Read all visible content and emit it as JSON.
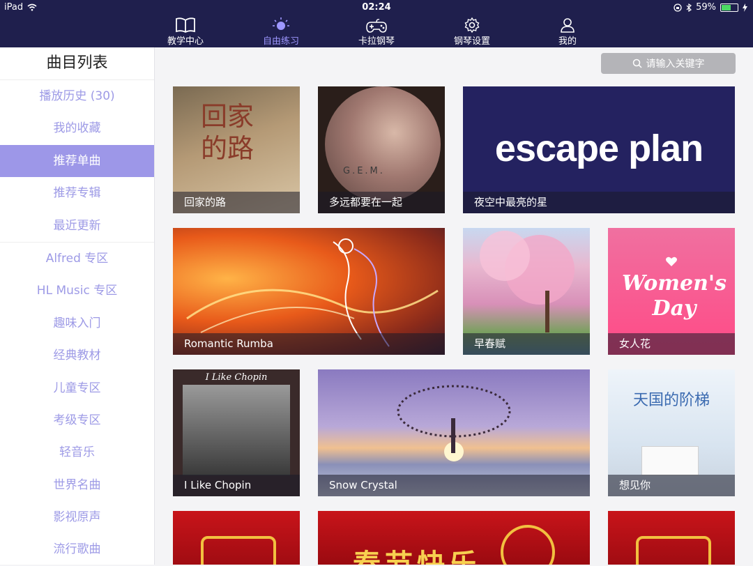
{
  "status": {
    "device": "iPad",
    "time": "02:24",
    "battery": "59%",
    "battery_level": 0.59
  },
  "nav": [
    {
      "label": "教学中心",
      "icon": "book-icon",
      "active": false
    },
    {
      "label": "自由练习",
      "icon": "sun-icon",
      "active": true
    },
    {
      "label": "卡拉钢琴",
      "icon": "gamepad-icon",
      "active": false
    },
    {
      "label": "钢琴设置",
      "icon": "gear-icon",
      "active": false
    },
    {
      "label": "我的",
      "icon": "user-icon",
      "active": false
    }
  ],
  "sidebar": {
    "title": "曲目列表",
    "items": [
      {
        "label": "播放历史 (30)"
      },
      {
        "label": "我的收藏"
      },
      {
        "label": "推荐单曲",
        "active": true
      },
      {
        "label": "推荐专辑"
      },
      {
        "label": "最近更新"
      },
      {
        "label": "Alfred 专区"
      },
      {
        "label": "HL Music 专区"
      },
      {
        "label": "趣味入门"
      },
      {
        "label": "经典教材"
      },
      {
        "label": "儿童专区"
      },
      {
        "label": "考级专区"
      },
      {
        "label": "轻音乐"
      },
      {
        "label": "世界名曲"
      },
      {
        "label": "影视原声"
      },
      {
        "label": "流行歌曲"
      }
    ]
  },
  "search": {
    "placeholder": "请输入关键字"
  },
  "tiles": {
    "t1": {
      "caption": "回家的路",
      "art_text": "回家的路"
    },
    "t2": {
      "caption": "多远都要在一起",
      "art_text": "G.E.M."
    },
    "t3": {
      "caption": "夜空中最亮的星",
      "art_text": "escape plan"
    },
    "t4": {
      "caption": "Romantic Rumba"
    },
    "t5": {
      "caption": "早春赋"
    },
    "t6": {
      "caption": "女人花",
      "art_text": "Women's Day"
    },
    "t7": {
      "caption": "I Like Chopin",
      "art_text": "I Like Chopin"
    },
    "t8": {
      "caption": "Snow Crystal"
    },
    "t9": {
      "caption": "想见你",
      "art_text": "天国的阶梯"
    },
    "t10": {},
    "t11": {
      "art_text": "春节快乐"
    },
    "t12": {}
  },
  "colors": {
    "nav_bg": "#1f1f4d",
    "accent": "#9d97e8",
    "sidebar_text": "#9d9ae6"
  }
}
